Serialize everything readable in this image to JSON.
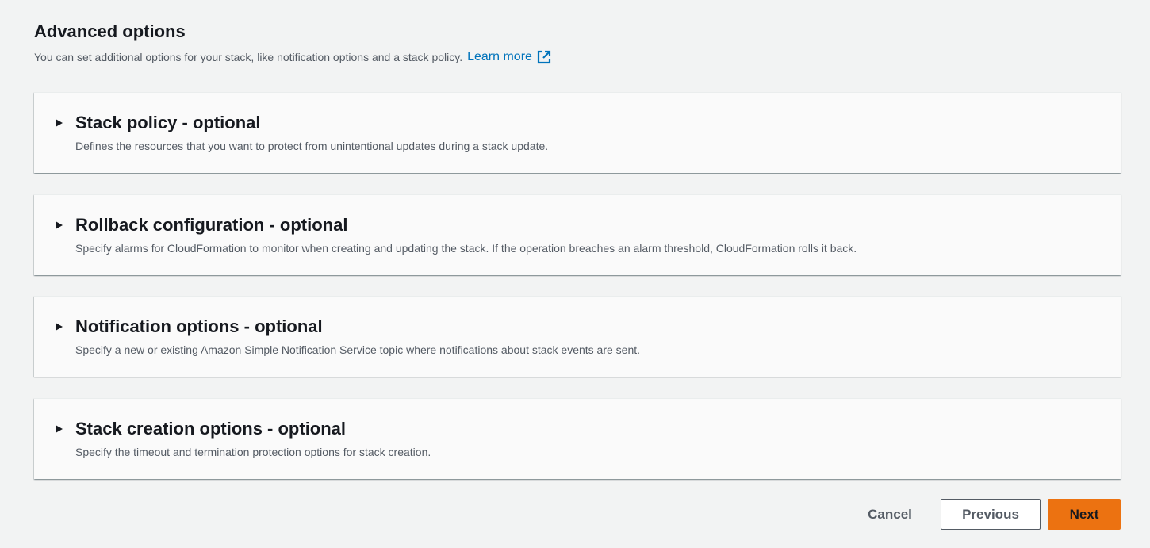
{
  "header": {
    "title": "Advanced options",
    "description": "You can set additional options for your stack, like notification options and a stack policy.",
    "learn_more": "Learn more"
  },
  "panels": [
    {
      "title": "Stack policy - optional",
      "description": "Defines the resources that you want to protect from unintentional updates during a stack update."
    },
    {
      "title": "Rollback configuration - optional",
      "description": "Specify alarms for CloudFormation to monitor when creating and updating the stack. If the operation breaches an alarm threshold, CloudFormation rolls it back."
    },
    {
      "title": "Notification options - optional",
      "description": "Specify a new or existing Amazon Simple Notification Service topic where notifications about stack events are sent."
    },
    {
      "title": "Stack creation options - optional",
      "description": "Specify the timeout and termination protection options for stack creation."
    }
  ],
  "footer": {
    "cancel_label": "Cancel",
    "previous_label": "Previous",
    "next_label": "Next"
  },
  "colors": {
    "background": "#f2f3f3",
    "link": "#0073bb",
    "primary_button": "#ec7211"
  }
}
